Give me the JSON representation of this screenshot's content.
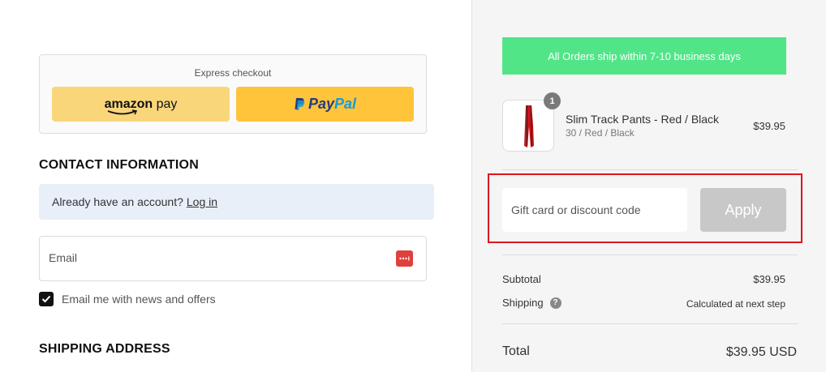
{
  "express": {
    "title": "Express checkout",
    "amazon_label_bold": "amazon",
    "amazon_label_rest": " pay",
    "paypal_pay": "Pay",
    "paypal_pal": "Pal"
  },
  "contact": {
    "heading": "CONTACT INFORMATION",
    "account_prompt": "Already have an account?",
    "login_link": "Log in",
    "email_placeholder": "Email",
    "newsletter_label": "Email me with news and offers",
    "newsletter_checked": true
  },
  "shipping": {
    "heading": "SHIPPING ADDRESS"
  },
  "summary": {
    "banner": "All Orders ship within 7-10 business days",
    "product": {
      "quantity": "1",
      "name": "Slim Track Pants - Red / Black",
      "variant": "30 / Red / Black",
      "price": "$39.95"
    },
    "discount_placeholder": "Gift card or discount code",
    "apply_label": "Apply",
    "subtotal_label": "Subtotal",
    "subtotal_value": "$39.95",
    "shipping_label": "Shipping",
    "shipping_value": "Calculated at next step",
    "total_label": "Total",
    "total_value": "$39.95 USD"
  },
  "colors": {
    "banner_green": "#51e588",
    "highlight_red": "#e0141e",
    "amazon_yellow": "#f9d67a",
    "paypal_yellow": "#ffc439"
  }
}
